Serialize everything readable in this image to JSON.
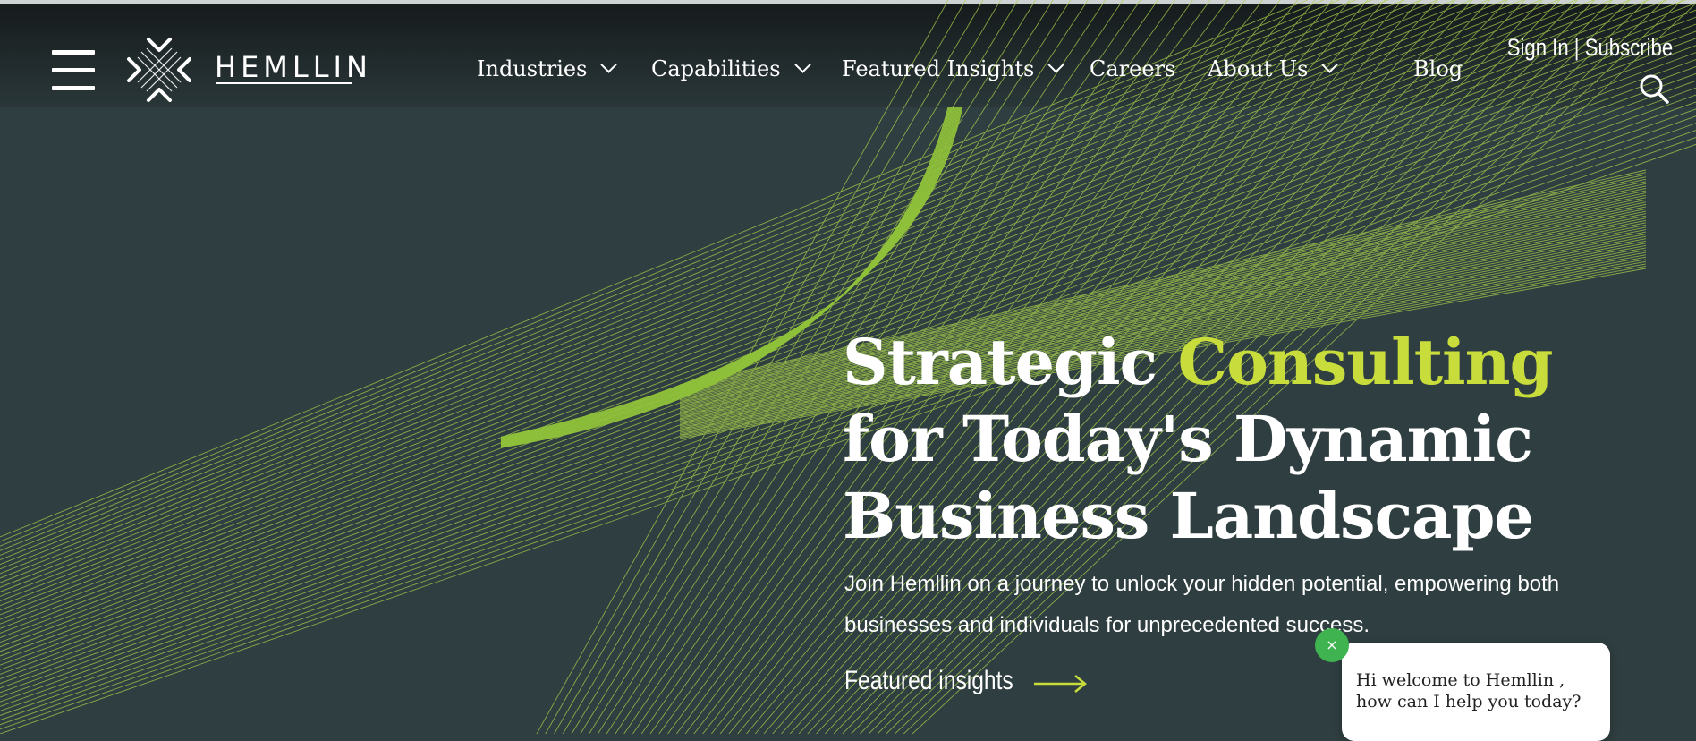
{
  "brand": {
    "name": "HEMLLIN",
    "accent_color": "#c8dc3c",
    "background_color": "#2f3e40"
  },
  "header": {
    "menu_icon": "hamburger-icon",
    "nav": [
      {
        "label": "Industries",
        "dropdown": true
      },
      {
        "label": "Capabilities",
        "dropdown": true
      },
      {
        "label": "Featured Insights",
        "dropdown": true
      },
      {
        "label": "Careers",
        "dropdown": false
      },
      {
        "label": "About Us",
        "dropdown": true
      },
      {
        "label": "Blog",
        "dropdown": false
      }
    ],
    "sign_in": "Sign In",
    "separator": "|",
    "subscribe": "Subscribe",
    "search_icon": "search-icon"
  },
  "hero": {
    "title_part1": "Strategic ",
    "title_accent": "Consulting",
    "title_part2": " for Today's Dynamic Business Landscape",
    "subtitle": "Join Hemllin on a journey to unlock your hidden potential, empowering both businesses and individuals for unprecedented success.",
    "cta_label": "Featured insights",
    "cta_icon": "arrow-right-icon"
  },
  "chat": {
    "close_label": "×",
    "message": "Hi welcome to Hemllin , how can I help you today?"
  }
}
